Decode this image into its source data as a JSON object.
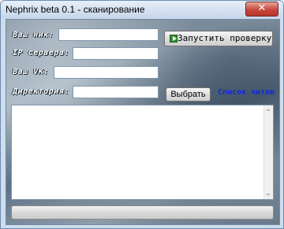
{
  "window": {
    "title": "Nephrix beta 0.1 - сканирование",
    "close_glyph": "✕"
  },
  "form": {
    "nick_label": "Ваш ник:",
    "nick_value": "",
    "ip_label": "IP сервера:",
    "ip_value": "",
    "vk_label": "Ваш VK:",
    "vk_value": "",
    "dir_label": "Директория:",
    "dir_value": ""
  },
  "buttons": {
    "run_label": "Запустить проверку",
    "run_icon": "play-icon",
    "pick_label": "Выбрать"
  },
  "links": {
    "cheat_list": "Список читов"
  },
  "log": {
    "text": ""
  },
  "progress": {
    "value": 0
  },
  "colors": {
    "link": "#1228d8",
    "run_icon": "#2f8f2f"
  }
}
